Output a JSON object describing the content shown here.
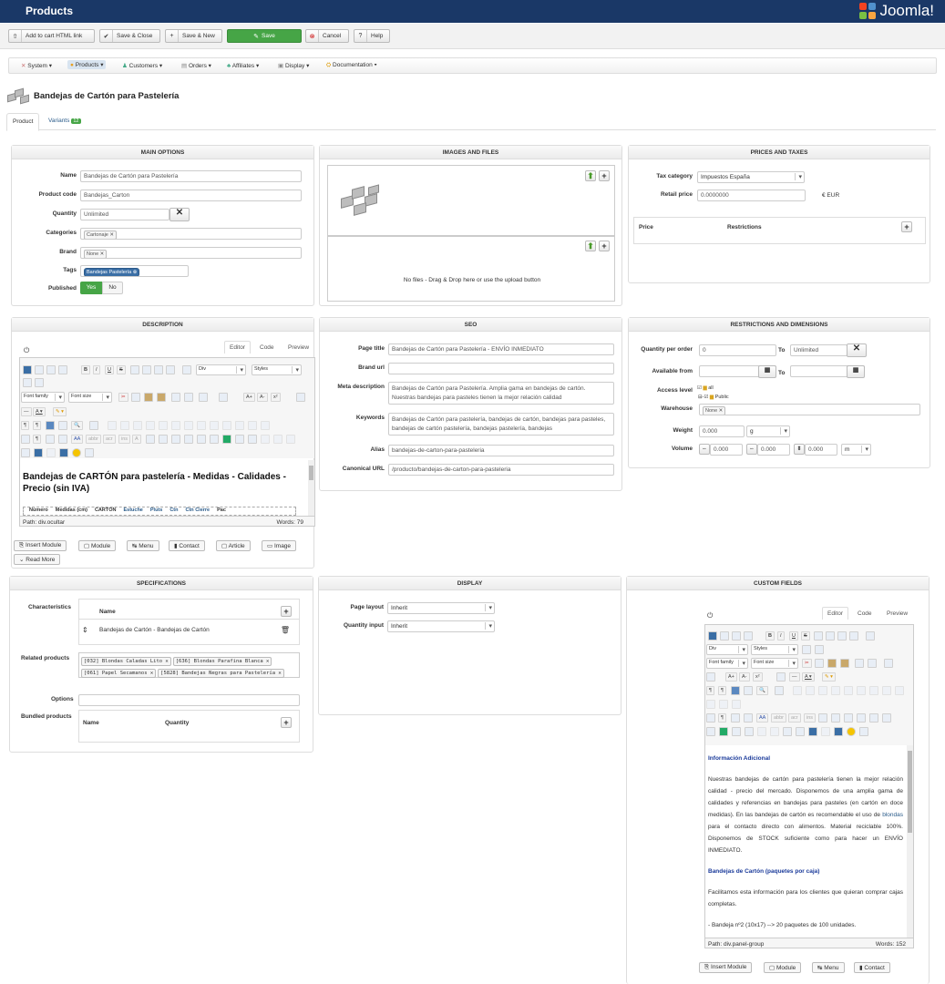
{
  "app": {
    "title": "Products",
    "brand": "Joomla!"
  },
  "toolbar": {
    "add_cart": "Add to cart HTML link",
    "save_close": "Save & Close",
    "save_new": "Save & New",
    "save": "Save",
    "cancel": "Cancel",
    "help": "Help"
  },
  "menu": [
    "System",
    "Products",
    "Customers",
    "Orders",
    "Affiliates",
    "Display",
    "Documentation"
  ],
  "product_title": "Bandejas de Cartón para Pastelería",
  "tabs": {
    "product": "Product",
    "variants": "Variants",
    "variants_count": "12"
  },
  "main": {
    "title": "MAIN OPTIONS",
    "name_label": "Name",
    "name": "Bandejas de Cartón para Pastelería",
    "code_label": "Product code",
    "code": "Bandejas_Carton",
    "qty_label": "Quantity",
    "qty": "Unlimited",
    "cat_label": "Categories",
    "cat": "Cartonaje",
    "brand_label": "Brand",
    "brand": "None",
    "tags_label": "Tags",
    "tag": "Bandejas Pastelería",
    "pub_label": "Published",
    "yes": "Yes",
    "no": "No"
  },
  "images": {
    "title": "IMAGES AND FILES",
    "nofiles": "No files - Drag & Drop here or use the upload button"
  },
  "prices": {
    "title": "PRICES AND TAXES",
    "taxcat_label": "Tax category",
    "taxcat": "Impuestos España",
    "retail_label": "Retail price",
    "retail": "0.0000000",
    "currency": "€ EUR",
    "col_price": "Price",
    "col_restr": "Restrictions"
  },
  "description": {
    "title": "DESCRIPTION",
    "tab_editor": "Editor",
    "tab_code": "Code",
    "tab_preview": "Preview",
    "fmt_div": "Div",
    "fmt_styles": "Styles",
    "font_family": "Font family",
    "font_size": "Font size",
    "heading": "Bandejas de CARTÓN para pastelería - Medidas - Calidades - Precio (sin IVA)",
    "table_head": [
      "Número",
      "Medidas (cm)",
      "CARTÓN",
      "Estuche",
      "Pluts",
      "Ctn",
      "Ctn Cierre",
      "Pac"
    ],
    "path": "Path: div.ocultar",
    "words": "Words: 79",
    "insert_module": "Insert Module",
    "module": "Module",
    "menu": "Menu",
    "contact": "Contact",
    "article": "Article",
    "image": "Image",
    "read_more": "Read More"
  },
  "seo": {
    "title": "SEO",
    "page_title_label": "Page title",
    "page_title": "Bandejas de Cartón para Pastelería - ENVÍO INMEDIATO",
    "brand_url_label": "Brand url",
    "brand_url": "",
    "meta_label": "Meta description",
    "meta": "Bandejas de Cartón para Pastelería. Amplia gama en bandejas de cartón. Nuestras bandejas para pasteles tienen la mejor relación calidad",
    "keywords_label": "Keywords",
    "keywords": "Bandejas de Cartón para pastelería, bandejas de cartón, bandejas para pasteles, bandejas de cartón pastelería, bandejas pastelería, bandejas",
    "alias_label": "Alias",
    "alias": "bandejas-de-carton-para-pasteleria",
    "canonical_label": "Canonical URL",
    "canonical": "/producto/bandejas-de-carton-para-pasteleria"
  },
  "restrictions": {
    "title": "RESTRICTIONS AND DIMENSIONS",
    "qpo_label": "Quantity per order",
    "qpo_from": "0",
    "to": "To",
    "qpo_to": "Unlimited",
    "avail_label": "Available from",
    "access_label": "Access level",
    "access_all": "all",
    "access_public": "Public",
    "warehouse_label": "Warehouse",
    "warehouse": "None",
    "weight_label": "Weight",
    "weight": "0.000",
    "weight_unit": "g",
    "volume_label": "Volume",
    "vol1": "0.000",
    "vol2": "0.000",
    "vol3": "0.000",
    "vol_unit": "m"
  },
  "specs": {
    "title": "SPECIFICATIONS",
    "char_label": "Characteristics",
    "col_name": "Name",
    "char_item": "Bandejas de Cartón - Bandejas de Cartón",
    "related_label": "Related products",
    "related": [
      "[032] Blondas Caladas Lito",
      "[636] Blondas Parafina Blanca",
      "[061] Papel Secamanos",
      "[5828] Bandejas Negras para Pastelería"
    ],
    "options_label": "Options",
    "bundled_label": "Bundled products",
    "col_qty": "Quantity"
  },
  "display": {
    "title": "DISPLAY",
    "layout_label": "Page layout",
    "layout": "Inherit",
    "qinput_label": "Quantity input",
    "qinput": "Inherit"
  },
  "custom": {
    "title": "CUSTOM FIELDS",
    "tab_editor": "Editor",
    "tab_code": "Code",
    "tab_preview": "Preview",
    "fmt_div": "Div",
    "fmt_styles": "Styles",
    "font_family": "Font family",
    "font_size": "Font size",
    "h1": "Información Adicional",
    "p1a": "Nuestras bandejas de cartón para pastelería tienen la mejor relación calidad - precio del mercado. Disponemos de una amplia gama de calidades y referencias en  bandejas para pasteles (en cartón en doce medidas). En las bandejas de cartón es recomendable el uso de ",
    "p1link": "blondas",
    "p1b": " para el contacto directo con alimentos. Material reciclable 100%. Disponemos de STOCK suficiente como para hacer un ENVÍO INMEDIATO.",
    "h2": "Bandejas de Cartón (paquetes por caja)",
    "p2": "Facilitamos esta información para los clientes que quieran comprar cajas completas.",
    "p3": "- Bandeja nº2 (10x17) --> 20 paquetes de 100 unidades.",
    "path": "Path: div.panel-group",
    "words": "Words: 152",
    "insert_module": "Insert Module",
    "module": "Module",
    "menu": "Menu",
    "contact": "Contact"
  }
}
